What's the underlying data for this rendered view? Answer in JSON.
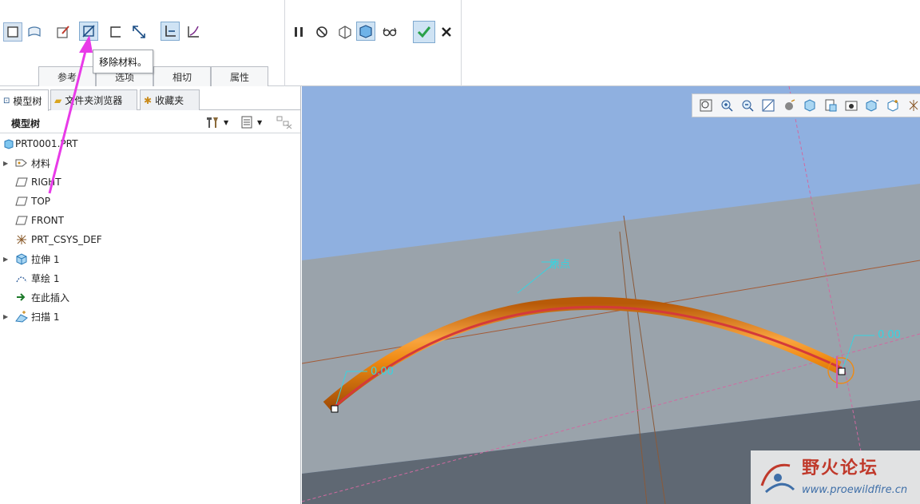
{
  "ribbon": {
    "tabs": [
      "参考",
      "选项",
      "相切",
      "属性"
    ],
    "tooltip": "移除材料。",
    "colors": {
      "active_button_bg": "#cfe3f4",
      "confirm": "#2aa14a"
    }
  },
  "left_panel": {
    "tabs": [
      "模型树",
      "文件夹浏览器",
      "收藏夹"
    ],
    "tree_title": "模型树",
    "items": [
      {
        "label": "PRT0001.PRT",
        "icon": "part-icon",
        "expandable": false
      },
      {
        "label": "材料",
        "icon": "material-icon",
        "expandable": true
      },
      {
        "label": "RIGHT",
        "icon": "datum-plane-icon",
        "expandable": false
      },
      {
        "label": "TOP",
        "icon": "datum-plane-icon",
        "expandable": false
      },
      {
        "label": "FRONT",
        "icon": "datum-plane-icon",
        "expandable": false
      },
      {
        "label": "PRT_CSYS_DEF",
        "icon": "csys-icon",
        "expandable": false
      },
      {
        "label": "拉伸 1",
        "icon": "extrude-icon",
        "expandable": true
      },
      {
        "label": "草绘 1",
        "icon": "sketch-icon",
        "expandable": false
      },
      {
        "label": "在此插入",
        "icon": "insert-here-icon",
        "expandable": false
      },
      {
        "label": "扫描 1",
        "icon": "sweep-icon",
        "expandable": true
      }
    ]
  },
  "viewport": {
    "annotations": {
      "origin_label": "原点",
      "left_value": "0.00",
      "right_value": "0.00"
    },
    "colors": {
      "sky": "#8fb0e0",
      "plane": "#9aa3ab",
      "dark_plane": "#5f6873",
      "sweep": "#ef8a12",
      "trajectory": "#d43a3a"
    }
  },
  "watermark": {
    "title": "野火论坛",
    "url": "www.proewildfire.cn"
  }
}
